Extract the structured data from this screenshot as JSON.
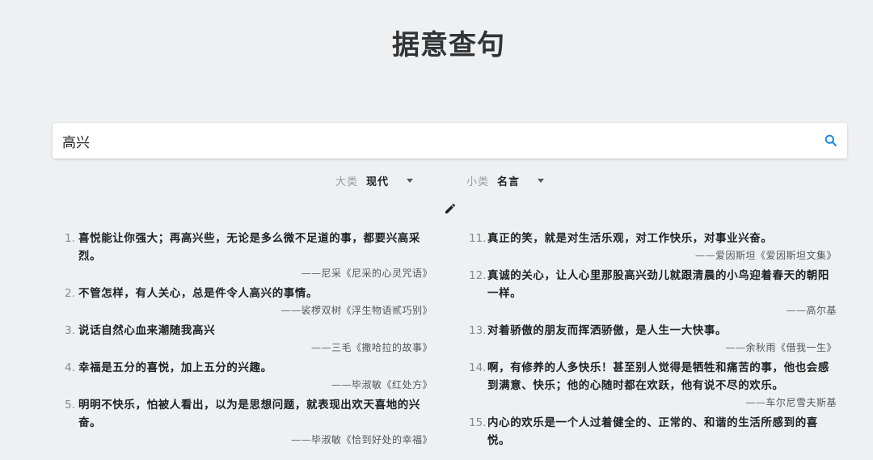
{
  "header": {
    "title": "据意查句"
  },
  "search": {
    "value": "高兴",
    "placeholder": ""
  },
  "filters": {
    "major": {
      "label": "大类",
      "value": "现代"
    },
    "minor": {
      "label": "小类",
      "value": "名言"
    }
  },
  "icons": {
    "search": "search-icon",
    "edit": "pencil-icon",
    "dropdown": "caret-down-icon"
  },
  "colors": {
    "accent": "#1e88e5",
    "background": "#eef0f2"
  },
  "results_left": [
    {
      "num": "1.",
      "text": "喜悦能让你强大；再高兴些，无论是多么微不足道的事，都要兴高采烈。",
      "source": "——尼采《尼采的心灵咒语》"
    },
    {
      "num": "2.",
      "text": "不管怎样，有人关心，总是件令人高兴的事情。",
      "source": "——裟椤双树《浮生物语贰巧别》"
    },
    {
      "num": "3.",
      "text": "说话自然心血来潮随我高兴",
      "source": "——三毛《撒哈拉的故事》"
    },
    {
      "num": "4.",
      "text": "幸福是五分的喜悦，加上五分的兴趣。",
      "source": "——毕淑敏《红处方》"
    },
    {
      "num": "5.",
      "text": "明明不快乐，怕被人看出，以为是思想问题，就表现出欢天喜地的兴奋。",
      "source": "——毕淑敏《恰到好处的幸福》"
    }
  ],
  "results_right": [
    {
      "num": "11.",
      "text": "真正的笑，就是对生活乐观，对工作快乐，对事业兴奋。",
      "source": "——爱因斯坦《爱因斯坦文集》"
    },
    {
      "num": "12.",
      "text": "真诚的关心，让人心里那股高兴劲儿就跟清晨的小鸟迎着春天的朝阳一样。",
      "source": "——高尔基"
    },
    {
      "num": "13.",
      "text": "对着骄傲的朋友而挥洒骄傲，是人生一大快事。",
      "source": "——余秋雨《借我一生》"
    },
    {
      "num": "14.",
      "text": "啊，有修养的人多快乐！甚至别人觉得是牺牲和痛苦的事，他也会感到满意、快乐；他的心随时都在欢跃，他有说不尽的欢乐。",
      "source": "——车尔尼雪夫斯基"
    },
    {
      "num": "15.",
      "text": "内心的欢乐是一个人过着健全的、正常的、和谐的生活所感到的喜悦。",
      "source": ""
    }
  ]
}
